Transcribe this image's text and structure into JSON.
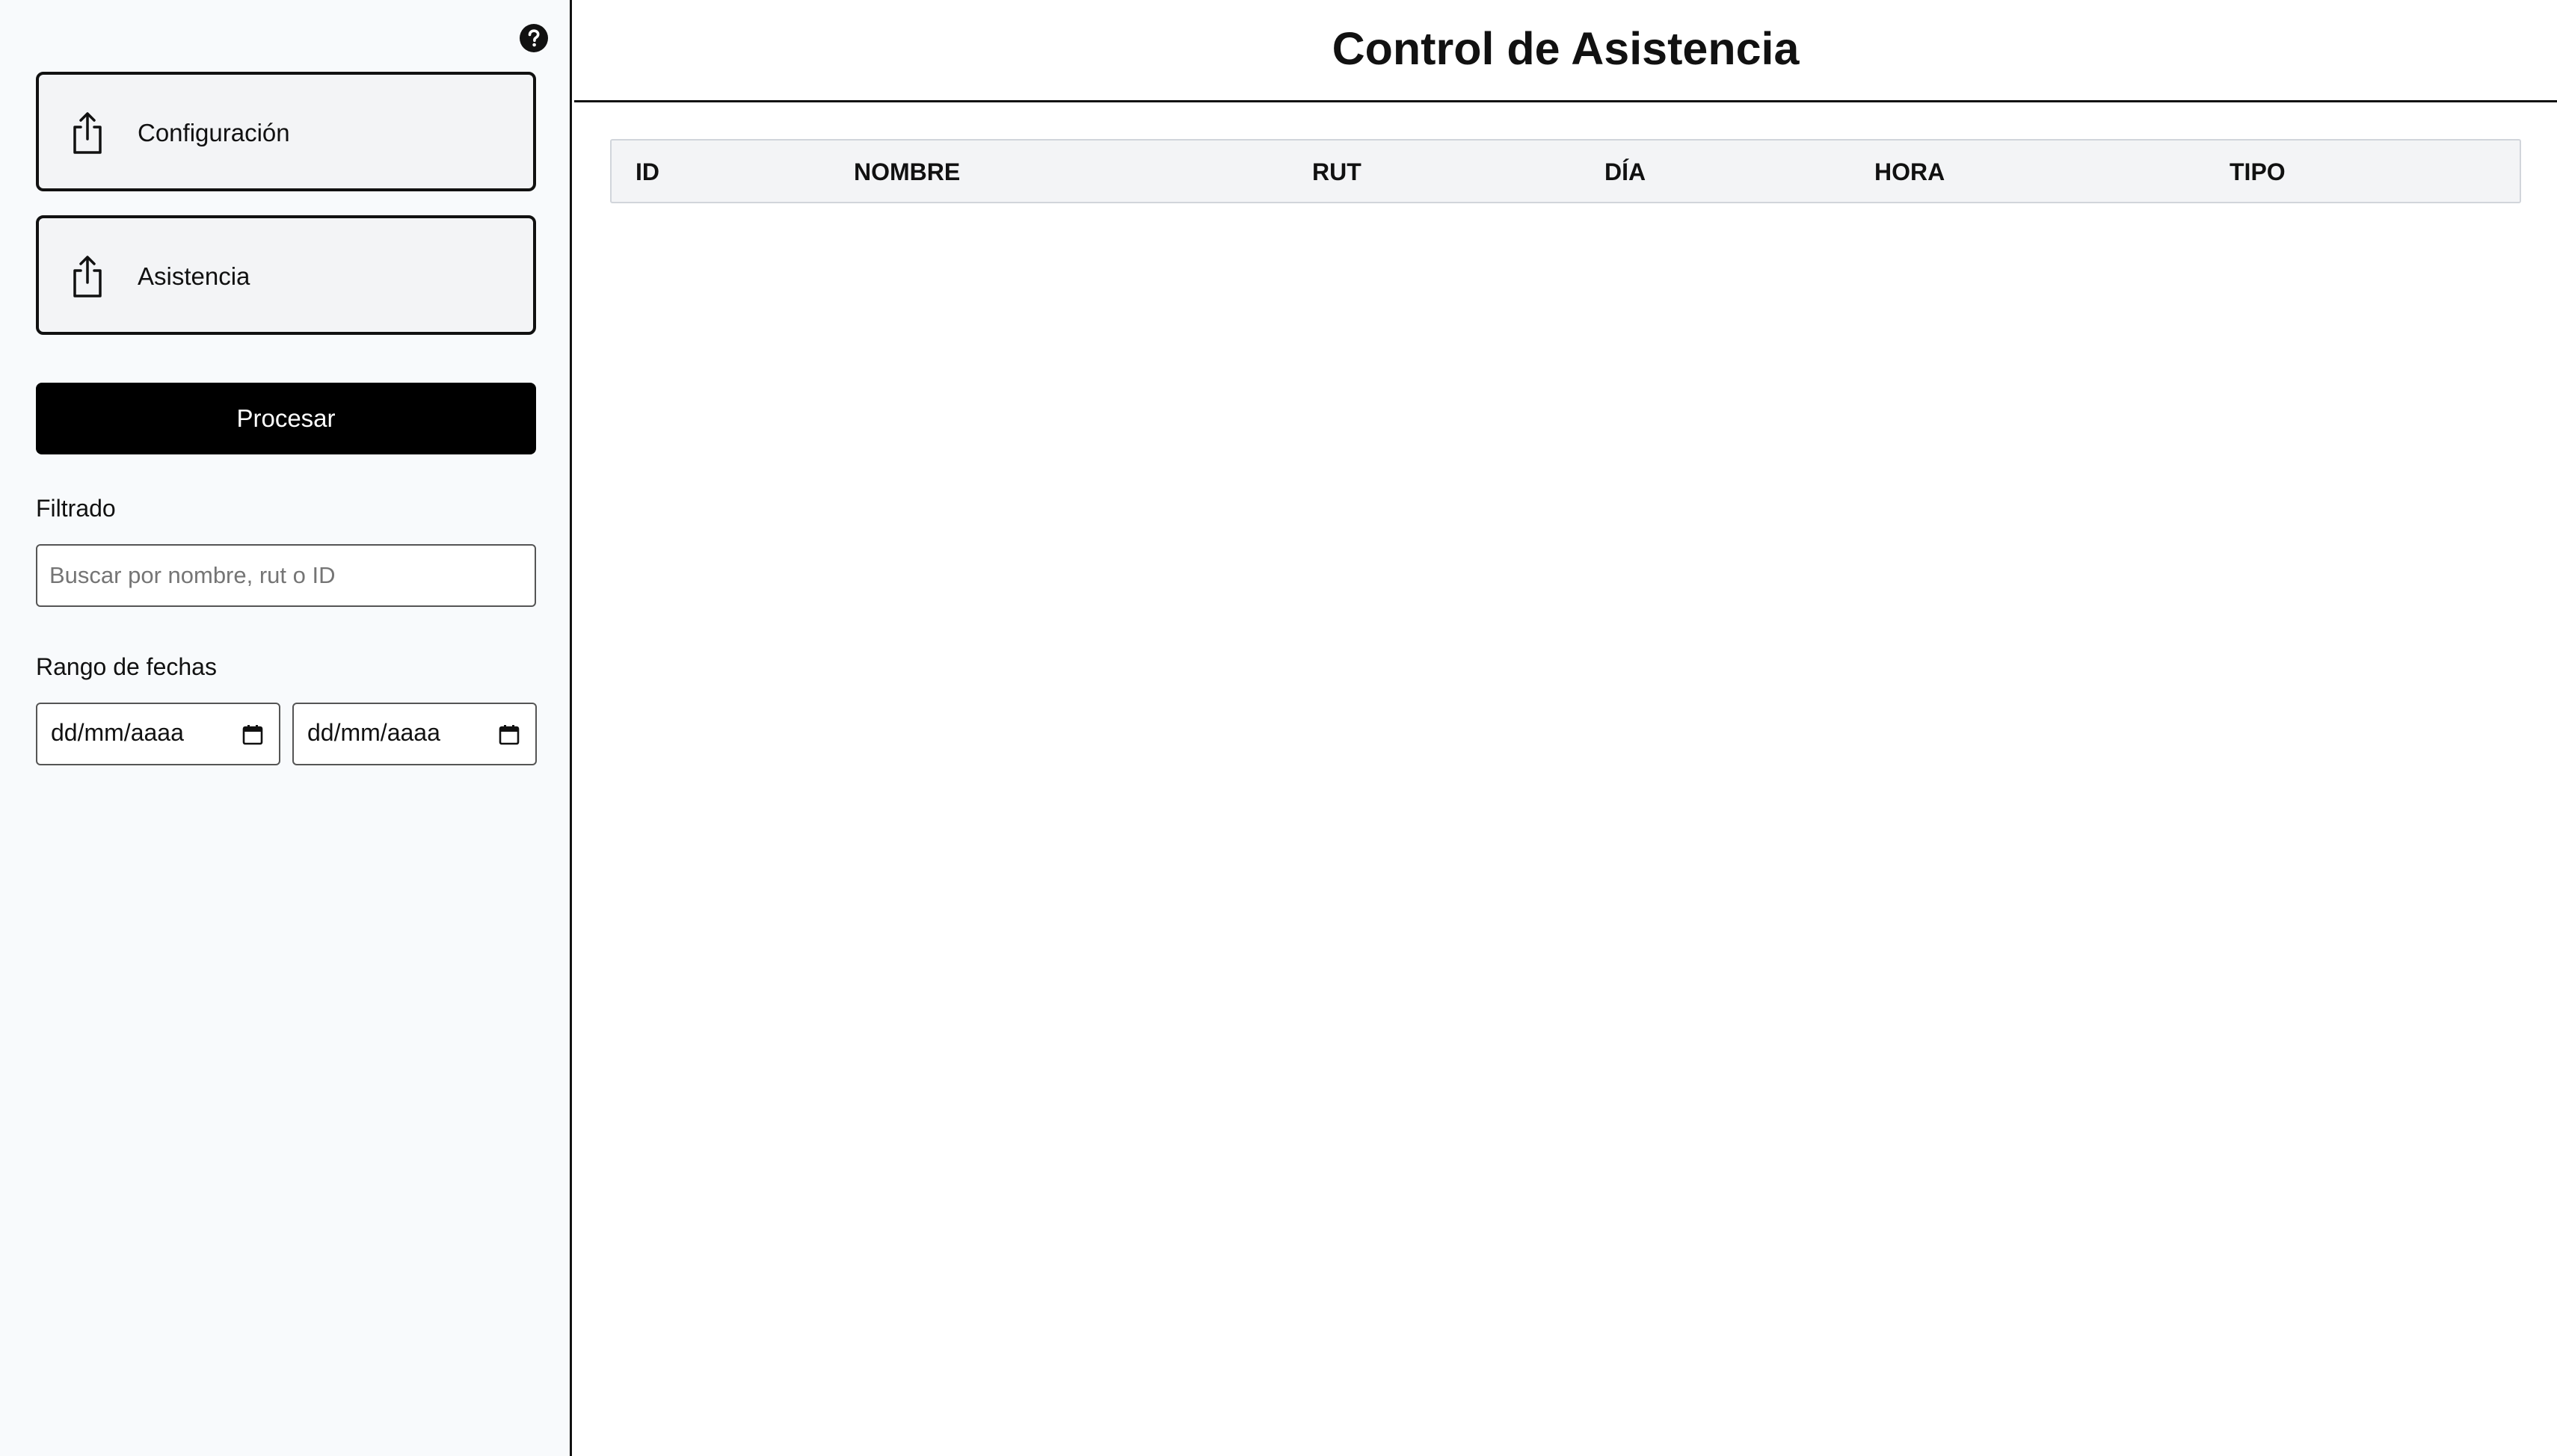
{
  "sidebar": {
    "help_icon": "question-circle-icon",
    "upload_buttons": [
      {
        "label": "Configuración",
        "icon": "share-upload-icon"
      },
      {
        "label": "Asistencia",
        "icon": "share-upload-icon"
      }
    ],
    "process_label": "Procesar",
    "filter": {
      "label": "Filtrado",
      "placeholder": "Buscar por nombre, rut o ID",
      "value": ""
    },
    "date_range": {
      "label": "Rango de fechas",
      "start": "dd/mm/aaaa",
      "end": "dd/mm/aaaa",
      "icon": "calendar-icon"
    }
  },
  "main": {
    "title": "Control de Asistencia",
    "table": {
      "columns": [
        "ID",
        "NOMBRE",
        "RUT",
        "DÍA",
        "HORA",
        "TIPO"
      ],
      "rows": []
    }
  },
  "colors": {
    "sidebar_bg": "#f8fafc",
    "button_bg": "#f3f4f6",
    "primary": "#000000",
    "header_bg": "#f3f4f6"
  }
}
